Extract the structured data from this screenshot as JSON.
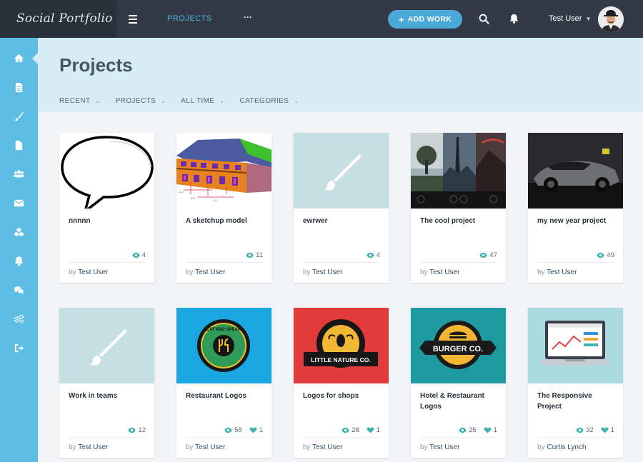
{
  "brand": "Social Portfolio",
  "topnav": {
    "projects_label": "PROJECTS",
    "more_label": "···",
    "add_work_label": "ADD WORK",
    "user_name": "Test User"
  },
  "sidebar": {
    "items": [
      "home-icon",
      "document-icon",
      "brush-icon",
      "file-icon",
      "users-icon",
      "envelope-icon",
      "cubes-icon",
      "bell-icon",
      "comments-icon",
      "cogs-icon",
      "sign-out-icon"
    ],
    "active": "home-icon"
  },
  "page": {
    "title": "Projects",
    "filters": [
      "RECENT",
      "PROJECTS",
      "ALL TIME",
      "CATEGORIES"
    ]
  },
  "projects": [
    {
      "title": "nnnnn",
      "views": "4",
      "likes": "",
      "by": "by",
      "author": "Test User"
    },
    {
      "title": "A sketchup model",
      "views": "11",
      "likes": "",
      "by": "by",
      "author": "Test User"
    },
    {
      "title": "ewrwer",
      "views": "4",
      "likes": "",
      "by": "by",
      "author": "Test User"
    },
    {
      "title": "The cool project",
      "views": "47",
      "likes": "",
      "by": "by",
      "author": "Test User"
    },
    {
      "title": "my new year project",
      "views": "49",
      "likes": "",
      "by": "by",
      "author": "Test User"
    },
    {
      "title": "Work in teams",
      "views": "12",
      "likes": "",
      "by": "by",
      "author": "Test User"
    },
    {
      "title": "Restaurant Logos",
      "views": "58",
      "likes": "1",
      "by": "by",
      "author": "Test User"
    },
    {
      "title": "Logos for shops",
      "views": "28",
      "likes": "1",
      "by": "by",
      "author": "Test User"
    },
    {
      "title": "Hotel & Restaurant Logos",
      "views": "25",
      "likes": "1",
      "by": "by",
      "author": "Test User"
    },
    {
      "title": "The Responsive Project",
      "views": "32",
      "likes": "1",
      "by": "by",
      "author": "Curtis Lynch"
    }
  ],
  "logo_text": {
    "eat_speak": "EAT AND SPEAK",
    "little_nature": "LITTLE NATURE CO.",
    "burger": "BURGER CO."
  },
  "colors": {
    "accent": "#4aa9d8",
    "sidebar": "#5dbde3",
    "header": "#d7edf6",
    "stat": "#3cb3b0"
  }
}
